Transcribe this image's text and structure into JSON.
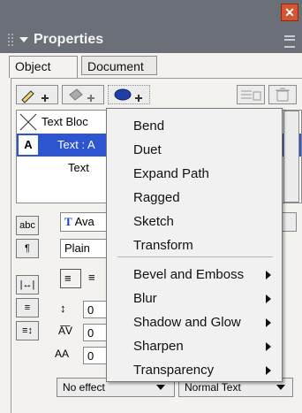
{
  "panel": {
    "title": "Properties"
  },
  "tabs": [
    {
      "label": "Object"
    },
    {
      "label": "Document"
    }
  ],
  "tree": {
    "rows": [
      {
        "label": "Text Bloc",
        "icon": "cross-icon"
      },
      {
        "label": "Text : A",
        "icon": "letter-a-icon"
      },
      {
        "label": "Text",
        "icon": ""
      }
    ]
  },
  "left_buttons": [
    {
      "label": "abc"
    },
    {
      "label": "¶"
    },
    {
      "label": "|↔|"
    },
    {
      "label": "≡"
    },
    {
      "label": "≡↕"
    }
  ],
  "fields": {
    "font": "Ava",
    "style": "Plain",
    "leading": "0",
    "tracking": "0",
    "baseline": "0"
  },
  "bottom": {
    "effect": "No effect",
    "blend": "Normal Text"
  },
  "context_menu": {
    "items": [
      {
        "label": "Bend",
        "submenu": false
      },
      {
        "label": "Duet",
        "submenu": false
      },
      {
        "label": "Expand Path",
        "submenu": false
      },
      {
        "label": "Ragged",
        "submenu": false
      },
      {
        "label": "Sketch",
        "submenu": false
      },
      {
        "label": "Transform",
        "submenu": false
      },
      {
        "label": "Bevel and Emboss",
        "submenu": true
      },
      {
        "label": "Blur",
        "submenu": true
      },
      {
        "label": "Shadow and Glow",
        "submenu": true
      },
      {
        "label": "Sharpen",
        "submenu": true
      },
      {
        "label": "Transparency",
        "submenu": true
      }
    ]
  },
  "colors": {
    "header": "#6b6f78",
    "selection": "#2d55d0",
    "close": "#d6542e"
  }
}
